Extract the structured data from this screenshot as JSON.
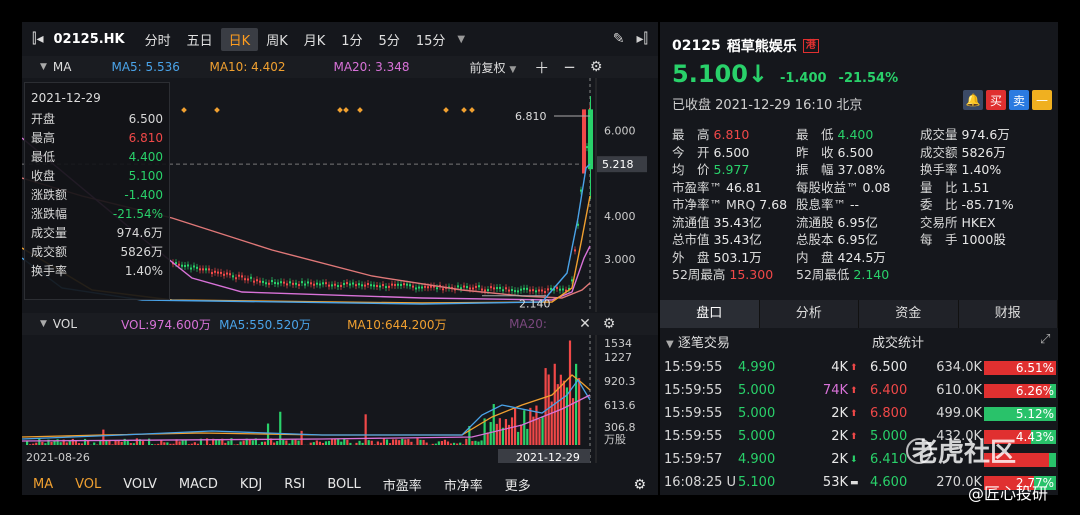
{
  "toolbar": {
    "symbol": "02125.HK",
    "tabs": [
      "分时",
      "五日",
      "日K",
      "周K",
      "月K",
      "1分",
      "5分",
      "15分"
    ],
    "active": "日K",
    "more": "▼"
  },
  "ma_bar": {
    "name": "MA",
    "ma5": "MA5: 5.536",
    "ma10": "MA10: 4.402",
    "ma20": "MA20: 3.348",
    "adjust": "前复权",
    "adjust_arrow": "▼"
  },
  "vol_bar": {
    "name": "VOL",
    "vol": "VOL:974.600万",
    "ma5": "MA5:550.520万",
    "ma10": "MA10:644.200万",
    "ma20": "MA20:"
  },
  "info_box": {
    "date": "2021-12-29",
    "rows": [
      {
        "label": "开盘",
        "value": "6.500",
        "color": "#d8d8d8"
      },
      {
        "label": "最高",
        "value": "6.810",
        "color": "#f04848"
      },
      {
        "label": "最低",
        "value": "4.400",
        "color": "#29d16a"
      },
      {
        "label": "收盘",
        "value": "5.100",
        "color": "#29d16a"
      },
      {
        "label": "涨跌额",
        "value": "-1.400",
        "color": "#29d16a"
      },
      {
        "label": "涨跌幅",
        "value": "-21.54%",
        "color": "#29d16a"
      },
      {
        "label": "成交量",
        "value": "974.6万",
        "color": "#d8d8d8"
      },
      {
        "label": "成交额",
        "value": "5826万",
        "color": "#d8d8d8"
      },
      {
        "label": "换手率",
        "value": "1.40%",
        "color": "#d8d8d8"
      }
    ]
  },
  "price_axis": {
    "labels": [
      "6.000",
      "4.000",
      "3.000"
    ],
    "current": "5.218",
    "high_label": "6.810",
    "low_label": "2.140"
  },
  "vol_axis": {
    "labels": [
      "1534",
      "1227",
      "920.3",
      "613.6",
      "306.8",
      "万股"
    ]
  },
  "dates": {
    "start": "2021-08-26",
    "cursor": "2021-12-29"
  },
  "bottom_tabs": [
    "MA",
    "VOL",
    "VOLV",
    "MACD",
    "KDJ",
    "RSI",
    "BOLL",
    "市盈率",
    "市净率",
    "更多"
  ],
  "bottom_active": [
    "MA",
    "VOL"
  ],
  "quote": {
    "code": "02125",
    "name": "稻草熊娱乐",
    "badge": "港",
    "price": "5.100",
    "arrow": "↓",
    "change": "-1.400",
    "change_pct": "-21.54%",
    "status": "已收盘  2021-12-29 16:10 北京",
    "buttons": [
      {
        "label": "🔔",
        "color": "#3b4a66"
      },
      {
        "label": "买",
        "color": "#e03030"
      },
      {
        "label": "卖",
        "color": "#2a7ae0"
      },
      {
        "label": "—",
        "color": "#f0b020"
      }
    ]
  },
  "stats": [
    [
      {
        "k": "最　高",
        "v": "6.810",
        "c": "red"
      },
      {
        "k": "最　低",
        "v": "4.400",
        "c": "green"
      },
      {
        "k": "成交量",
        "v": "974.6万",
        "c": "white"
      }
    ],
    [
      {
        "k": "今　开",
        "v": "6.500",
        "c": "white"
      },
      {
        "k": "昨　收",
        "v": "6.500",
        "c": "white"
      },
      {
        "k": "成交额",
        "v": "5826万",
        "c": "white"
      }
    ],
    [
      {
        "k": "均　价",
        "v": "5.977",
        "c": "green"
      },
      {
        "k": "振　幅",
        "v": "37.08%",
        "c": "white"
      },
      {
        "k": "换手率",
        "v": "1.40%",
        "c": "white"
      }
    ],
    [
      {
        "k": "市盈率™",
        "v": "46.81",
        "c": "white"
      },
      {
        "k": "每股收益™",
        "v": "0.08",
        "c": "white"
      },
      {
        "k": "量　比",
        "v": "1.51",
        "c": "white"
      }
    ],
    [
      {
        "k": "市净率™ MRQ",
        "v": "7.68",
        "c": "white"
      },
      {
        "k": "股息率™",
        "v": "--",
        "c": "white"
      },
      {
        "k": "委　比",
        "v": "-85.71%",
        "c": "white"
      }
    ],
    [
      {
        "k": "流通值",
        "v": "35.43亿",
        "c": "white"
      },
      {
        "k": "流通股",
        "v": "6.95亿",
        "c": "white"
      },
      {
        "k": "交易所",
        "v": "HKEX",
        "c": "white"
      }
    ],
    [
      {
        "k": "总市值",
        "v": "35.43亿",
        "c": "white"
      },
      {
        "k": "总股本",
        "v": "6.95亿",
        "c": "white"
      },
      {
        "k": "每　手",
        "v": "1000股",
        "c": "white"
      }
    ],
    [
      {
        "k": "外　盘",
        "v": "503.1万",
        "c": "white"
      },
      {
        "k": "内　盘",
        "v": "424.5万",
        "c": "white"
      },
      {
        "k": "",
        "v": "",
        "c": "white"
      }
    ],
    [
      {
        "k": "52周最高",
        "v": "15.300",
        "c": "red"
      },
      {
        "k": "52周最低",
        "v": "2.140",
        "c": "green"
      },
      {
        "k": "",
        "v": "",
        "c": "white"
      }
    ]
  ],
  "rp_tabs": [
    "盘口",
    "分析",
    "资金",
    "财报"
  ],
  "rp_active": "盘口",
  "trades_title": "逐笔交易",
  "dist_title": "成交统计",
  "trades": [
    {
      "time": "15:59:55",
      "price": "4.990",
      "vol": "4K",
      "dir": "up",
      "vc": "white"
    },
    {
      "time": "15:59:55",
      "price": "5.000",
      "vol": "74K",
      "dir": "up",
      "vc": "purple"
    },
    {
      "time": "15:59:55",
      "price": "5.000",
      "vol": "2K",
      "dir": "up",
      "vc": "white"
    },
    {
      "time": "15:59:55",
      "price": "5.000",
      "vol": "2K",
      "dir": "up",
      "vc": "white"
    },
    {
      "time": "15:59:57",
      "price": "4.900",
      "vol": "2K",
      "dir": "down",
      "vc": "white"
    },
    {
      "time": "16:08:25 U",
      "price": "5.100",
      "vol": "53K",
      "dir": "flat",
      "vc": "white"
    }
  ],
  "dist": [
    {
      "price": "6.500",
      "vol": "634.0K",
      "pct": "6.51%",
      "buy": 1.0,
      "pc": "white"
    },
    {
      "price": "6.400",
      "vol": "610.0K",
      "pct": "6.26%",
      "buy": 0.92,
      "pc": "red"
    },
    {
      "price": "6.800",
      "vol": "499.0K",
      "pct": "5.12%",
      "buy": 0.0,
      "pc": "red"
    },
    {
      "price": "5.000",
      "vol": "432.0K",
      "pct": "4.43%",
      "buy": 0.65,
      "pc": "green"
    },
    {
      "price": "6.410",
      "vol": "",
      "pct": "",
      "buy": 0.9,
      "pc": "green"
    },
    {
      "price": "4.600",
      "vol": "270.0K",
      "pct": "2.77%",
      "buy": 0.7,
      "pc": "green"
    }
  ],
  "watermark": {
    "main": "老虎社区",
    "sub": "@匠心投研"
  }
}
